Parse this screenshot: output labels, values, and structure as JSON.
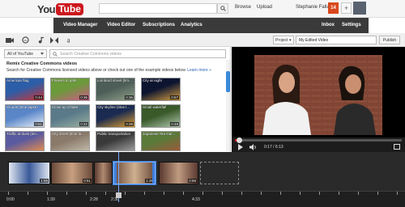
{
  "header": {
    "logo_you": "You",
    "logo_tube": "Tube",
    "search_placeholder": "",
    "browse": "Browse",
    "upload": "Upload",
    "username": "Stephanie Falla",
    "notifications": "14",
    "plus": "+"
  },
  "nav": {
    "items": [
      {
        "label": "Video Manager"
      },
      {
        "label": "Video Editor"
      },
      {
        "label": "Subscriptions"
      },
      {
        "label": "Analytics"
      },
      {
        "label": "Inbox"
      },
      {
        "label": "Settings"
      }
    ]
  },
  "toolbar": {
    "tools": [
      "camera-icon",
      "cc-icon",
      "music-icon",
      "transition-icon",
      "text-icon"
    ],
    "project_select": "Project ▾",
    "project_name": "My Edited Video",
    "publish": "Publish"
  },
  "library": {
    "filter": "All of YouTube",
    "search_placeholder": "Search Creative Commons videos",
    "title": "Remix Creative Commons videos",
    "description": "Search for Creative Commons licensed videos above or check out one of the example videos below.",
    "learn_more": "Learn more »",
    "thumbnails": [
      {
        "title": "American flag",
        "duration": "0:44",
        "colors": [
          "#2c5ea8",
          "#c33"
        ]
      },
      {
        "title": "Flowers in park",
        "duration": "0:36",
        "colors": [
          "#6a9a3a",
          "#d05a8a"
        ]
      },
      {
        "title": "Lombard street (tim...",
        "duration": "0:36",
        "colors": [
          "#4d5e58",
          "#8fa08a"
        ]
      },
      {
        "title": "City at night",
        "duration": "0:57",
        "colors": [
          "#0c1430",
          "#d8a040"
        ]
      },
      {
        "title": "Clouds (time lapse)",
        "duration": "0:51",
        "colors": [
          "#5a86c8",
          "#e8f0fa"
        ]
      },
      {
        "title": "Close up of lake",
        "duration": "0:22",
        "colors": [
          "#5a7a8a",
          "#9bb0a0"
        ]
      },
      {
        "title": "City skyline (time l...",
        "duration": "0:39",
        "colors": [
          "#1a2a50",
          "#e0a030"
        ]
      },
      {
        "title": "Small waterfall",
        "duration": "0:48",
        "colors": [
          "#3a5a2a",
          "#b0c8b0"
        ]
      },
      {
        "title": "Traffic at dusk (tim...",
        "duration": "",
        "colors": [
          "#5a5aa0",
          "#e08a50"
        ]
      },
      {
        "title": "City street (time la...",
        "duration": "",
        "colors": [
          "#8a7a6a",
          "#c0b8a8"
        ]
      },
      {
        "title": "Public transportation",
        "duration": "",
        "colors": [
          "#3a3a3a",
          "#9a9a9a"
        ]
      },
      {
        "title": "Japanese Tea Gar...",
        "duration": "",
        "colors": [
          "#5a7a3a",
          "#9a5a3a"
        ]
      }
    ]
  },
  "player": {
    "progress": 0.02,
    "timecode": "0:17 / 6:13"
  },
  "timeline": {
    "clips": [
      {
        "duration": "1:59",
        "colors": [
          "#dfe6f0",
          "#3a5a9a"
        ]
      },
      {
        "duration": "0:51",
        "colors": [
          "#6a4a3a",
          "#c8a080"
        ]
      },
      {
        "duration": "",
        "colors": [
          "#5a3a30",
          "#b08a70"
        ]
      },
      {
        "duration": "1:39",
        "colors": [
          "#6a4a3a",
          "#d0b090"
        ]
      },
      {
        "duration": "0:58",
        "colors": [
          "#5a3a30",
          "#c09a80"
        ]
      }
    ],
    "ticks": [
      "0:00",
      "1:39",
      "2:28",
      "2:30",
      "4:33"
    ]
  }
}
